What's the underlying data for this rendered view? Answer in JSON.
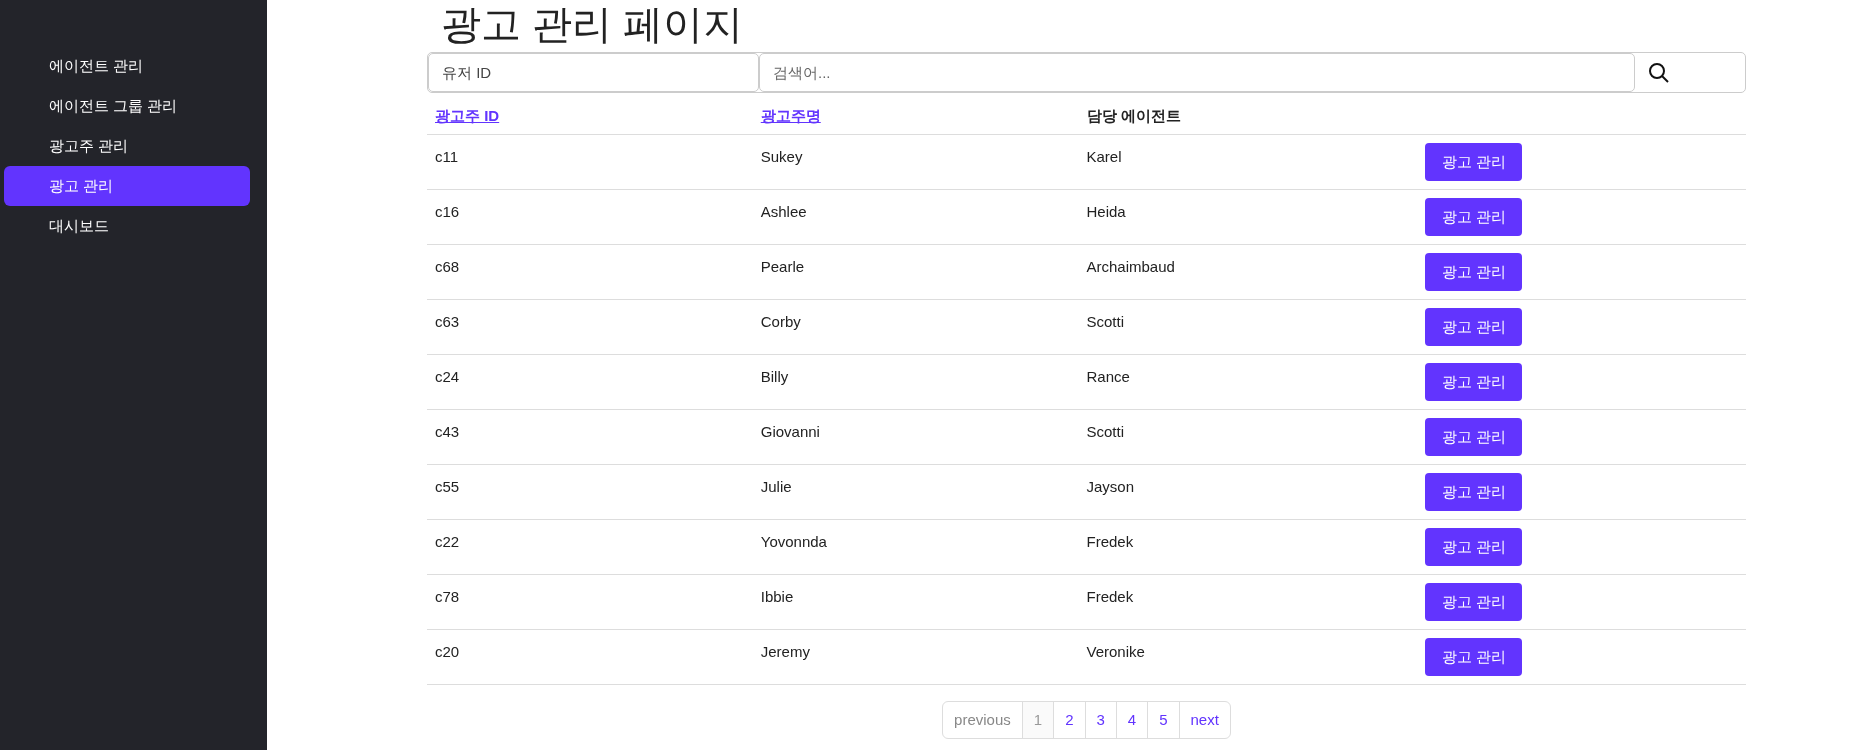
{
  "sidebar": {
    "items": [
      {
        "label": "에이전트 관리",
        "selected": false
      },
      {
        "label": "에이전트 그룹 관리",
        "selected": false
      },
      {
        "label": "광고주 관리",
        "selected": false
      },
      {
        "label": "광고 관리",
        "selected": true
      },
      {
        "label": "대시보드",
        "selected": false
      }
    ]
  },
  "page_title": "광고 관리 페이지",
  "search": {
    "user_id_placeholder": "유저 ID",
    "keyword_placeholder": "검색어..."
  },
  "table": {
    "columns": [
      {
        "label": "광고주 ID",
        "sortable": true
      },
      {
        "label": "광고주명",
        "sortable": true
      },
      {
        "label": "담당 에이전트",
        "sortable": false
      }
    ],
    "rows": [
      {
        "id": "c11",
        "name": "Sukey",
        "agent": "Karel",
        "action": "광고 관리"
      },
      {
        "id": "c16",
        "name": "Ashlee",
        "agent": "Heida",
        "action": "광고 관리"
      },
      {
        "id": "c68",
        "name": "Pearle",
        "agent": "Archaimbaud",
        "action": "광고 관리"
      },
      {
        "id": "c63",
        "name": "Corby",
        "agent": "Scotti",
        "action": "광고 관리"
      },
      {
        "id": "c24",
        "name": "Billy",
        "agent": "Rance",
        "action": "광고 관리"
      },
      {
        "id": "c43",
        "name": "Giovanni",
        "agent": "Scotti",
        "action": "광고 관리"
      },
      {
        "id": "c55",
        "name": "Julie",
        "agent": "Jayson",
        "action": "광고 관리"
      },
      {
        "id": "c22",
        "name": "Yovonnda",
        "agent": "Fredek",
        "action": "광고 관리"
      },
      {
        "id": "c78",
        "name": "Ibbie",
        "agent": "Fredek",
        "action": "광고 관리"
      },
      {
        "id": "c20",
        "name": "Jeremy",
        "agent": "Veronike",
        "action": "광고 관리"
      }
    ]
  },
  "pagination": [
    {
      "label": "previous",
      "selected": false,
      "disabled": true
    },
    {
      "label": "1",
      "selected": true,
      "disabled": false
    },
    {
      "label": "2",
      "selected": false,
      "disabled": false
    },
    {
      "label": "3",
      "selected": false,
      "disabled": false
    },
    {
      "label": "4",
      "selected": false,
      "disabled": false
    },
    {
      "label": "5",
      "selected": false,
      "disabled": false
    },
    {
      "label": "next",
      "selected": false,
      "disabled": false
    }
  ]
}
